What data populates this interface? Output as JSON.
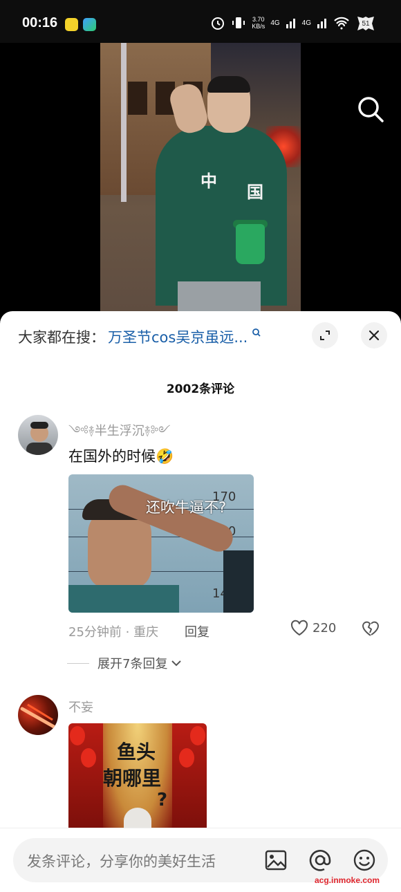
{
  "status_bar": {
    "time": "00:16",
    "speed_value": "3.70",
    "speed_unit": "KB/s",
    "network_1": "4G",
    "network_2": "4G"
  },
  "video": {
    "jacket_text_left": "中",
    "jacket_text_right": "国"
  },
  "sheet": {
    "hot_search_label": "大家都在搜：",
    "hot_search_query": "万圣节cos吴京虽远...",
    "comment_count": "2002条评论"
  },
  "comments": [
    {
      "username": "༺࿈半生浮沉࿈༻",
      "text": "在国外的时候🤣",
      "image_caption": "还吹牛逼不?",
      "ruler_marks": [
        "170",
        "160",
        "140"
      ],
      "time": "25分钟前 · 重庆",
      "reply_label": "回复",
      "likes": "220",
      "expand_label": "展开7条回复"
    },
    {
      "username": "不妄",
      "image_caption_line1": "鱼头",
      "image_caption_line2": "朝哪里",
      "image_caption_line3": "?"
    }
  ],
  "input_bar": {
    "placeholder": "发条评论，分享你的美好生活"
  },
  "watermark": "acg.inmoke.com",
  "colors": {
    "accent_link": "#1a5fa8",
    "watermark": "#e0262e"
  }
}
